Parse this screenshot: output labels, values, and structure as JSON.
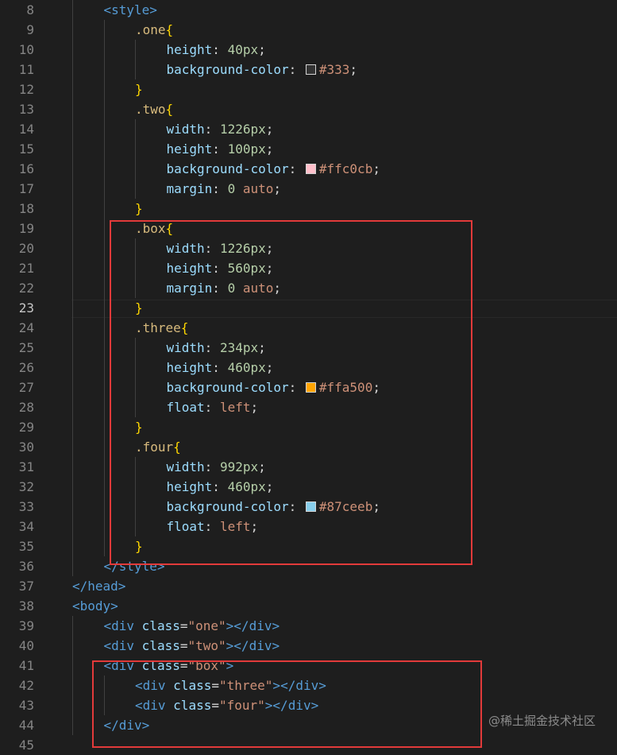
{
  "editor": {
    "active_line": "23",
    "lines": [
      {
        "num": "8",
        "indent": 2,
        "tokens": [
          [
            "tag",
            "<style>"
          ]
        ]
      },
      {
        "num": "9",
        "indent": 3,
        "tokens": [
          [
            "sel",
            ".one"
          ],
          [
            "brace",
            "{"
          ]
        ]
      },
      {
        "num": "10",
        "indent": 4,
        "tokens": [
          [
            "prop",
            "height"
          ],
          [
            "plain",
            ": "
          ],
          [
            "num",
            "40px"
          ],
          [
            "plain",
            ";"
          ]
        ]
      },
      {
        "num": "11",
        "indent": 4,
        "tokens": [
          [
            "prop",
            "background-color"
          ],
          [
            "plain",
            ": "
          ],
          [
            "swatch",
            "#333333"
          ],
          [
            "val",
            "#333"
          ],
          [
            "plain",
            ";"
          ]
        ]
      },
      {
        "num": "12",
        "indent": 3,
        "tokens": [
          [
            "brace",
            "}"
          ]
        ]
      },
      {
        "num": "13",
        "indent": 3,
        "tokens": [
          [
            "sel",
            ".two"
          ],
          [
            "brace",
            "{"
          ]
        ]
      },
      {
        "num": "14",
        "indent": 4,
        "tokens": [
          [
            "prop",
            "width"
          ],
          [
            "plain",
            ": "
          ],
          [
            "num",
            "1226px"
          ],
          [
            "plain",
            ";"
          ]
        ]
      },
      {
        "num": "15",
        "indent": 4,
        "tokens": [
          [
            "prop",
            "height"
          ],
          [
            "plain",
            ": "
          ],
          [
            "num",
            "100px"
          ],
          [
            "plain",
            ";"
          ]
        ]
      },
      {
        "num": "16",
        "indent": 4,
        "tokens": [
          [
            "prop",
            "background-color"
          ],
          [
            "plain",
            ": "
          ],
          [
            "swatch",
            "#ffc0cb"
          ],
          [
            "val",
            "#ffc0cb"
          ],
          [
            "plain",
            ";"
          ]
        ]
      },
      {
        "num": "17",
        "indent": 4,
        "tokens": [
          [
            "prop",
            "margin"
          ],
          [
            "plain",
            ": "
          ],
          [
            "num",
            "0"
          ],
          [
            "plain",
            " "
          ],
          [
            "val",
            "auto"
          ],
          [
            "plain",
            ";"
          ]
        ]
      },
      {
        "num": "18",
        "indent": 3,
        "tokens": [
          [
            "brace",
            "}"
          ]
        ]
      },
      {
        "num": "19",
        "indent": 3,
        "tokens": [
          [
            "sel",
            ".box"
          ],
          [
            "brace",
            "{"
          ]
        ]
      },
      {
        "num": "20",
        "indent": 4,
        "tokens": [
          [
            "prop",
            "width"
          ],
          [
            "plain",
            ": "
          ],
          [
            "num",
            "1226px"
          ],
          [
            "plain",
            ";"
          ]
        ]
      },
      {
        "num": "21",
        "indent": 4,
        "tokens": [
          [
            "prop",
            "height"
          ],
          [
            "plain",
            ": "
          ],
          [
            "num",
            "560px"
          ],
          [
            "plain",
            ";"
          ]
        ]
      },
      {
        "num": "22",
        "indent": 4,
        "tokens": [
          [
            "prop",
            "margin"
          ],
          [
            "plain",
            ": "
          ],
          [
            "num",
            "0"
          ],
          [
            "plain",
            " "
          ],
          [
            "val",
            "auto"
          ],
          [
            "plain",
            ";"
          ]
        ]
      },
      {
        "num": "23",
        "indent": 3,
        "tokens": [
          [
            "brace",
            "}"
          ]
        ]
      },
      {
        "num": "24",
        "indent": 3,
        "tokens": [
          [
            "sel",
            ".three"
          ],
          [
            "brace",
            "{"
          ]
        ]
      },
      {
        "num": "25",
        "indent": 4,
        "tokens": [
          [
            "prop",
            "width"
          ],
          [
            "plain",
            ": "
          ],
          [
            "num",
            "234px"
          ],
          [
            "plain",
            ";"
          ]
        ]
      },
      {
        "num": "26",
        "indent": 4,
        "tokens": [
          [
            "prop",
            "height"
          ],
          [
            "plain",
            ": "
          ],
          [
            "num",
            "460px"
          ],
          [
            "plain",
            ";"
          ]
        ]
      },
      {
        "num": "27",
        "indent": 4,
        "tokens": [
          [
            "prop",
            "background-color"
          ],
          [
            "plain",
            ": "
          ],
          [
            "swatch",
            "#ffa500"
          ],
          [
            "val",
            "#ffa500"
          ],
          [
            "plain",
            ";"
          ]
        ]
      },
      {
        "num": "28",
        "indent": 4,
        "tokens": [
          [
            "prop",
            "float"
          ],
          [
            "plain",
            ": "
          ],
          [
            "val",
            "left"
          ],
          [
            "plain",
            ";"
          ]
        ]
      },
      {
        "num": "29",
        "indent": 3,
        "tokens": [
          [
            "brace",
            "}"
          ]
        ]
      },
      {
        "num": "30",
        "indent": 3,
        "tokens": [
          [
            "sel",
            ".four"
          ],
          [
            "brace",
            "{"
          ]
        ]
      },
      {
        "num": "31",
        "indent": 4,
        "tokens": [
          [
            "prop",
            "width"
          ],
          [
            "plain",
            ": "
          ],
          [
            "num",
            "992px"
          ],
          [
            "plain",
            ";"
          ]
        ]
      },
      {
        "num": "32",
        "indent": 4,
        "tokens": [
          [
            "prop",
            "height"
          ],
          [
            "plain",
            ": "
          ],
          [
            "num",
            "460px"
          ],
          [
            "plain",
            ";"
          ]
        ]
      },
      {
        "num": "33",
        "indent": 4,
        "tokens": [
          [
            "prop",
            "background-color"
          ],
          [
            "plain",
            ": "
          ],
          [
            "swatch",
            "#87ceeb"
          ],
          [
            "val",
            "#87ceeb"
          ],
          [
            "plain",
            ";"
          ]
        ]
      },
      {
        "num": "34",
        "indent": 4,
        "tokens": [
          [
            "prop",
            "float"
          ],
          [
            "plain",
            ": "
          ],
          [
            "val",
            "left"
          ],
          [
            "plain",
            ";"
          ]
        ]
      },
      {
        "num": "35",
        "indent": 3,
        "tokens": [
          [
            "brace",
            "}"
          ]
        ]
      },
      {
        "num": "36",
        "indent": 2,
        "tokens": [
          [
            "tag",
            "</style>"
          ]
        ]
      },
      {
        "num": "37",
        "indent": 1,
        "tokens": [
          [
            "tag",
            "</head>"
          ]
        ]
      },
      {
        "num": "38",
        "indent": 1,
        "tokens": [
          [
            "tag",
            "<body>"
          ]
        ]
      },
      {
        "num": "39",
        "indent": 2,
        "tokens": [
          [
            "tag",
            "<div"
          ],
          [
            "plain",
            " "
          ],
          [
            "attr",
            "class"
          ],
          [
            "plain",
            "="
          ],
          [
            "str",
            "\"one\""
          ],
          [
            "tag",
            ">"
          ],
          [
            "tag",
            "</div>"
          ]
        ]
      },
      {
        "num": "40",
        "indent": 2,
        "tokens": [
          [
            "tag",
            "<div"
          ],
          [
            "plain",
            " "
          ],
          [
            "attr",
            "class"
          ],
          [
            "plain",
            "="
          ],
          [
            "str",
            "\"two\""
          ],
          [
            "tag",
            ">"
          ],
          [
            "tag",
            "</div>"
          ]
        ]
      },
      {
        "num": "41",
        "indent": 2,
        "tokens": [
          [
            "tag",
            "<div"
          ],
          [
            "plain",
            " "
          ],
          [
            "attr",
            "class"
          ],
          [
            "plain",
            "="
          ],
          [
            "str",
            "\"box\""
          ],
          [
            "tag",
            ">"
          ]
        ]
      },
      {
        "num": "42",
        "indent": 3,
        "tokens": [
          [
            "tag",
            "<div"
          ],
          [
            "plain",
            " "
          ],
          [
            "attr",
            "class"
          ],
          [
            "plain",
            "="
          ],
          [
            "str",
            "\"three\""
          ],
          [
            "tag",
            ">"
          ],
          [
            "tag",
            "</div>"
          ]
        ]
      },
      {
        "num": "43",
        "indent": 3,
        "tokens": [
          [
            "tag",
            "<div"
          ],
          [
            "plain",
            " "
          ],
          [
            "attr",
            "class"
          ],
          [
            "plain",
            "="
          ],
          [
            "str",
            "\"four\""
          ],
          [
            "tag",
            ">"
          ],
          [
            "tag",
            "</div>"
          ]
        ]
      },
      {
        "num": "44",
        "indent": 2,
        "tokens": [
          [
            "tag",
            "</div>"
          ]
        ]
      },
      {
        "num": "45",
        "indent": 1,
        "tokens": []
      }
    ]
  },
  "watermark": "@稀土掘金技术社区",
  "colors": {
    "tag": "#569cd6",
    "attr": "#9cdcfe",
    "str": "#ce9178",
    "sel": "#d7ba7d",
    "prop": "#9cdcfe",
    "num": "#b5cea8",
    "val": "#ce9178",
    "brace": "#ffd700",
    "plain": "#d4d4d4",
    "highlight": "#e23a3a"
  }
}
